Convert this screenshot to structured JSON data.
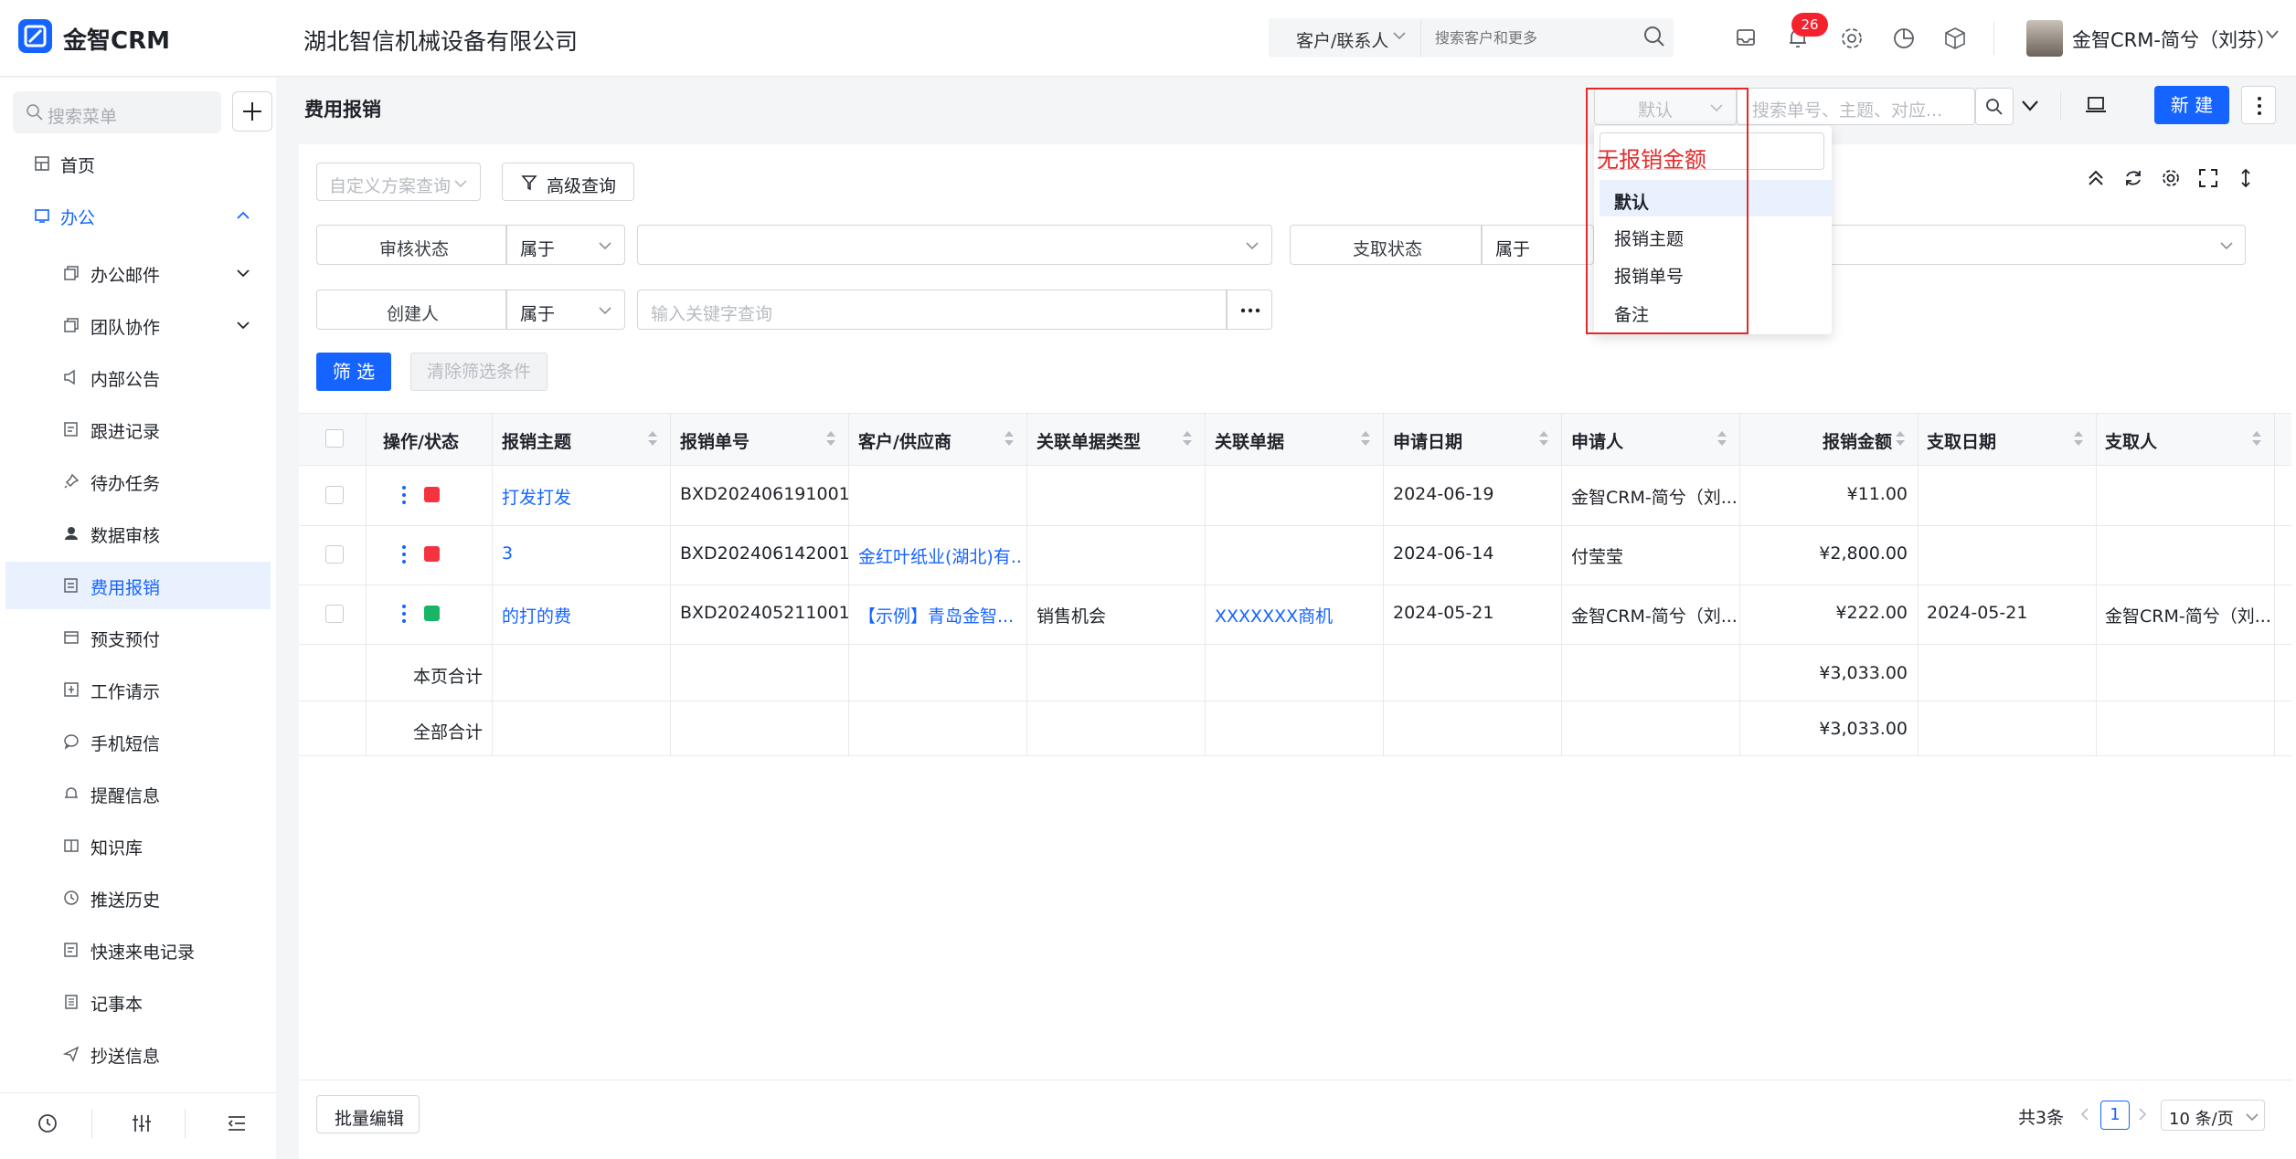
{
  "app": {
    "name": "金智CRM",
    "company": "湖北智信机械设备有限公司"
  },
  "topbar": {
    "search_scope": "客户/联系人",
    "search_placeholder": "搜索客户和更多",
    "notification_count": "26",
    "user_name": "金智CRM-简兮（刘芬）"
  },
  "sidebar": {
    "search_placeholder": "搜索菜单",
    "items": [
      {
        "label": "首页",
        "icon": "home-icon"
      },
      {
        "label": "办公",
        "icon": "office-icon"
      },
      {
        "label": "办公邮件",
        "icon": "mail-icon"
      },
      {
        "label": "团队协作",
        "icon": "team-icon"
      },
      {
        "label": "内部公告",
        "icon": "announcement-icon"
      },
      {
        "label": "跟进记录",
        "icon": "followup-icon"
      },
      {
        "label": "待办任务",
        "icon": "task-icon"
      },
      {
        "label": "数据审核",
        "icon": "audit-icon"
      },
      {
        "label": "费用报销",
        "icon": "expense-icon"
      },
      {
        "label": "预支预付",
        "icon": "prepay-icon"
      },
      {
        "label": "工作请示",
        "icon": "request-icon"
      },
      {
        "label": "手机短信",
        "icon": "sms-icon"
      },
      {
        "label": "提醒信息",
        "icon": "reminder-icon"
      },
      {
        "label": "知识库",
        "icon": "knowledge-icon"
      },
      {
        "label": "推送历史",
        "icon": "history-icon"
      },
      {
        "label": "快速来电记录",
        "icon": "call-icon"
      },
      {
        "label": "记事本",
        "icon": "notebook-icon"
      },
      {
        "label": "抄送信息",
        "icon": "cc-icon"
      }
    ]
  },
  "page": {
    "title": "费用报销",
    "view_select": "默认",
    "search_placeholder": "搜索单号、主题、对应...",
    "new_button": "新 建"
  },
  "filters": {
    "scheme_placeholder": "自定义方案查询",
    "advanced": "高级查询",
    "audit_status": "审核状态",
    "belongs": "属于",
    "payout_status": "支取状态",
    "creator": "创建人",
    "keyword_placeholder": "输入关键字查询",
    "filter_button": "筛 选",
    "clear_button": "清除筛选条件"
  },
  "table": {
    "columns": [
      "操作/状态",
      "报销主题",
      "报销单号",
      "客户/供应商",
      "关联单据类型",
      "关联单据",
      "申请日期",
      "申请人",
      "报销金额",
      "支取日期",
      "支取人"
    ],
    "rows": [
      {
        "subject": "打发打发",
        "no": "BXD202406191001",
        "customer": "",
        "rel_type": "",
        "rel_doc": "",
        "date": "2024-06-19",
        "applicant": "金智CRM-简兮（刘...",
        "amount": "¥11.00",
        "pay_date": "",
        "payee": "",
        "status": "red"
      },
      {
        "subject": "3",
        "no": "BXD202406142001",
        "customer": "金红叶纸业(湖北)有...",
        "rel_type": "",
        "rel_doc": "",
        "date": "2024-06-14",
        "applicant": "付莹莹",
        "amount": "¥2,800.00",
        "pay_date": "",
        "payee": "",
        "status": "red"
      },
      {
        "subject": "的打的费",
        "no": "BXD202405211001",
        "customer": "【示例】青岛金智...",
        "rel_type": "销售机会",
        "rel_doc": "XXXXXXX商机",
        "date": "2024-05-21",
        "applicant": "金智CRM-简兮（刘...",
        "amount": "¥222.00",
        "pay_date": "2024-05-21",
        "payee": "金智CRM-简兮（刘...",
        "status": "green"
      }
    ],
    "page_total_label": "本页合计",
    "page_total": "¥3,033.00",
    "all_total_label": "全部合计",
    "all_total": "¥3,033.00"
  },
  "footer": {
    "batch_edit": "批量编辑",
    "total": "共3条",
    "page": "1",
    "page_size": "10 条/页"
  },
  "dropdown": {
    "items": [
      "默认",
      "报销主题",
      "报销单号",
      "备注"
    ],
    "annotation": "无报销金额"
  },
  "colors": {
    "accent": "#1664ff",
    "annotation": "#e5292b",
    "status_red": "#f5333f",
    "status_green": "#18b566"
  }
}
